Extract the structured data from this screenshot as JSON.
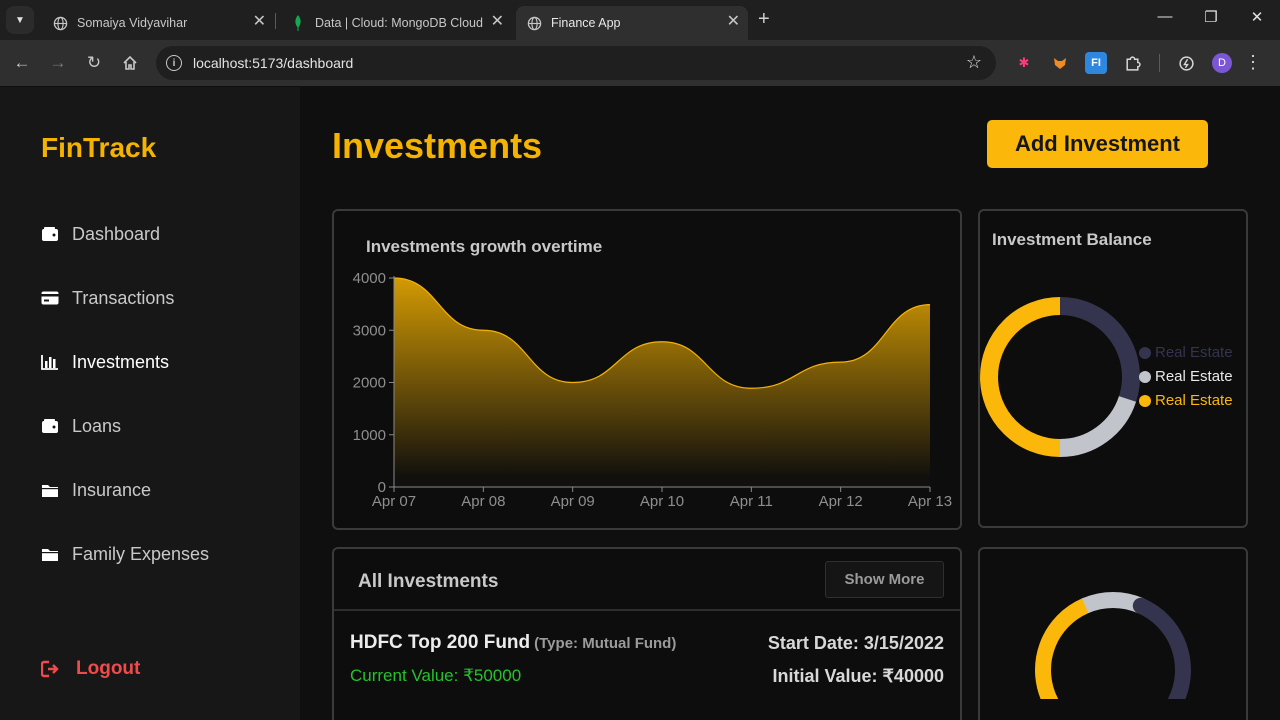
{
  "browser": {
    "tabs": [
      {
        "title": "Somaiya Vidyavihar",
        "active": false
      },
      {
        "title": "Data | Cloud: MongoDB Cloud",
        "active": false
      },
      {
        "title": "Finance App",
        "active": true
      }
    ],
    "url": "localhost:5173/dashboard",
    "profile_initial": "D",
    "extensions": [
      "puzzle-red-icon",
      "fox-icon",
      "fi-icon",
      "extensions-puzzle-icon",
      "performance-icon"
    ]
  },
  "sidebar": {
    "brand": "FinTrack",
    "items": [
      {
        "label": "Dashboard",
        "icon": "wallet-icon"
      },
      {
        "label": "Transactions",
        "icon": "credit-card-icon"
      },
      {
        "label": "Investments",
        "icon": "bar-chart-icon",
        "active": true
      },
      {
        "label": "Loans",
        "icon": "wallet-icon"
      },
      {
        "label": "Insurance",
        "icon": "folder-icon"
      },
      {
        "label": "Family Expenses",
        "icon": "folder-icon"
      }
    ],
    "logout_label": "Logout"
  },
  "main": {
    "title": "Investments",
    "add_button_label": "Add Investment",
    "growth_card_title": "Investments growth overtime",
    "balance_card_title": "Investment Balance",
    "list_title": "All Investments",
    "show_more_label": "Show More",
    "investment": {
      "name": "HDFC Top 200 Fund",
      "type": "(Type: Mutual Fund)",
      "current_value": "Current Value: ₹50000",
      "start_date": "Start Date: 3/15/2022",
      "initial_value": "Initial Value: ₹40000"
    }
  },
  "chart_data": [
    {
      "type": "area",
      "title": "Investments growth overtime",
      "categories": [
        "Apr 07",
        "Apr 08",
        "Apr 09",
        "Apr 10",
        "Apr 11",
        "Apr 12",
        "Apr 13"
      ],
      "values": [
        4000,
        3000,
        2000,
        2780,
        1890,
        2390,
        3490
      ],
      "ylim": [
        0,
        4000
      ],
      "yticks": [
        0,
        1000,
        2000,
        3000,
        4000
      ],
      "color": "#f5b301"
    },
    {
      "type": "pie",
      "title": "Investment Balance",
      "style": "donut",
      "slices": [
        {
          "label": "Real Estate",
          "value": 30,
          "color": "#34344e"
        },
        {
          "label": "Real Estate",
          "value": 20,
          "color": "#c2c4cc"
        },
        {
          "label": "Real Estate",
          "value": 50,
          "color": "#fbb80a"
        }
      ],
      "legend": "right"
    },
    {
      "type": "pie",
      "style": "semi-donut",
      "slices": [
        {
          "value": 40,
          "color": "#fbb80a"
        },
        {
          "value": 20,
          "color": "#c2c4cc"
        },
        {
          "value": 40,
          "color": "#34344e"
        }
      ]
    }
  ]
}
